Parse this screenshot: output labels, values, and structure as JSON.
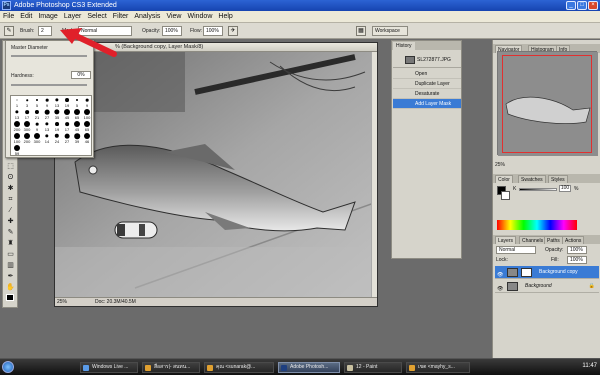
{
  "titlebar": {
    "title": "Adobe Photoshop CS3 Extended",
    "logo": "Ps"
  },
  "menubar": {
    "items": [
      "File",
      "Edit",
      "Image",
      "Layer",
      "Select",
      "Filter",
      "Analysis",
      "View",
      "Window",
      "Help"
    ]
  },
  "options_bar": {
    "brush_label": "Brush:",
    "brush_size": "2",
    "mode_label": "Mode:",
    "mode_value": "Normal",
    "opacity_label": "Opacity:",
    "opacity_value": "100%",
    "flow_label": "Flow:",
    "flow_value": "100%",
    "workspace_label": "Workspace"
  },
  "brush_popup": {
    "master_diameter_label": "Master Diameter",
    "hardness_label": "Hardness:",
    "hardness_value": "0%",
    "brush_sizes": [
      "1",
      "3",
      "5",
      "9",
      "13",
      "19",
      "5",
      "9",
      "13",
      "17",
      "21",
      "27",
      "35",
      "45",
      "65",
      "100",
      "200",
      "300",
      "9",
      "13",
      "19",
      "17",
      "45",
      "65",
      "100",
      "200",
      "300",
      "14",
      "24",
      "27",
      "39",
      "46",
      "59"
    ]
  },
  "document": {
    "title": "% (Background copy, Layer Mask/8)",
    "zoom": "25%",
    "doc_info": "Doc: 20.3M/40.5M"
  },
  "history_panel": {
    "tab": "History",
    "snapshot": "SL272877.JPG",
    "steps": [
      "Open",
      "Duplicate Layer",
      "Desaturate",
      "Add Layer Mask"
    ],
    "selected_index": 3
  },
  "navigator_panel": {
    "tabs": [
      "Navigator",
      "Histogram",
      "Info"
    ],
    "zoom": "25%"
  },
  "color_panel": {
    "tabs": [
      "Color",
      "Swatches",
      "Styles"
    ],
    "channel_label": "K",
    "value": "100",
    "unit": "%"
  },
  "layers_panel": {
    "tabs": [
      "Layers",
      "Channels",
      "Paths",
      "Actions"
    ],
    "blend_mode": "Normal",
    "opacity_label": "Opacity:",
    "opacity_value": "100%",
    "lock_label": "Lock:",
    "fill_label": "Fill:",
    "fill_value": "100%",
    "layers": [
      {
        "name": "Background copy",
        "selected": true
      },
      {
        "name": "Background",
        "selected": false
      }
    ]
  },
  "taskbar": {
    "tasks": [
      {
        "label": "Windows Live ...",
        "active": false
      },
      {
        "label": "สื่อสาร|- สนทน...",
        "active": false
      },
      {
        "label": "คุณ <sunarak@...",
        "active": false
      },
      {
        "label": "Adobe Photosh...",
        "active": true
      },
      {
        "label": "12 - Paint",
        "active": false
      },
      {
        "label": "เขต <mayhy_s...",
        "active": false
      }
    ],
    "clock": "11:47"
  },
  "colors": {
    "accent": "#3a7bd5",
    "titlebar": "#1f55c5",
    "arrow": "#e0202a"
  }
}
